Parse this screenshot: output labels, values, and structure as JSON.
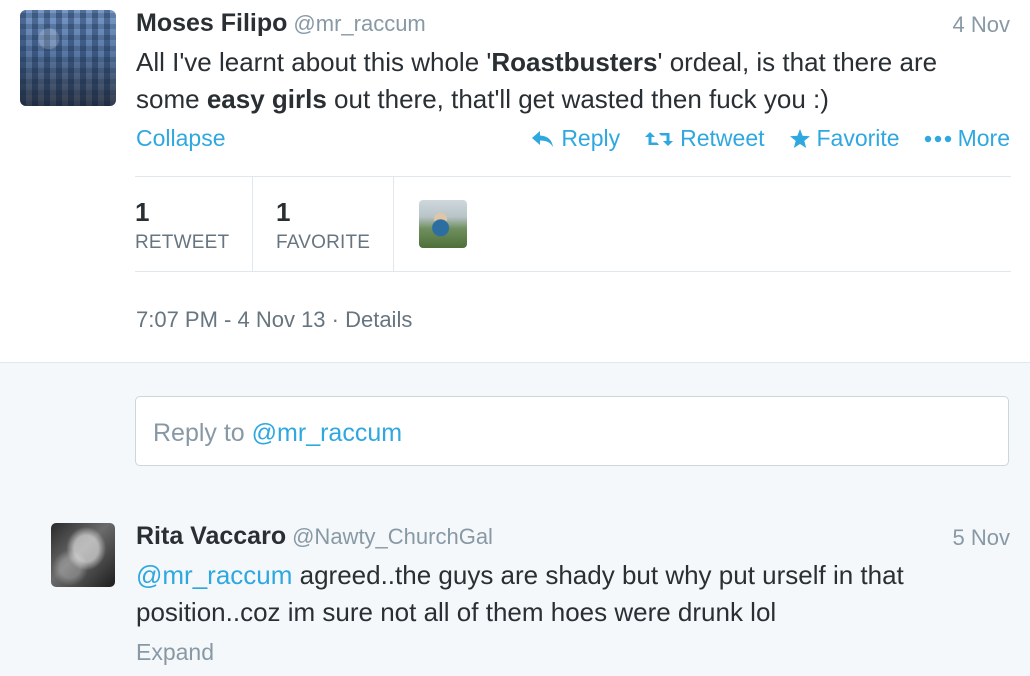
{
  "tweet": {
    "name": "Moses Filipo",
    "handle": "@mr_raccum",
    "time": "4 Nov",
    "text_parts": {
      "p1": "All I've learnt about this whole '",
      "b1": "Roastbusters",
      "p2": "' ordeal, is that there are some ",
      "b2": "easy girls",
      "p3": " out there, that'll get wasted then fuck you :)"
    },
    "collapse_label": "Collapse",
    "actions": {
      "reply": "Reply",
      "retweet": "Retweet",
      "favorite": "Favorite",
      "more": "More"
    },
    "stats": {
      "retweet_count": "1",
      "retweet_label": "RETWEET",
      "favorite_count": "1",
      "favorite_label": "FAVORITE"
    },
    "meta": "7:07 PM - 4 Nov 13 · Details"
  },
  "reply_box": {
    "prefix": "Reply to ",
    "mention": "@mr_raccum"
  },
  "reply_tweet": {
    "name": "Rita Vaccaro",
    "handle": "@Nawty_ChurchGal",
    "time": "5 Nov",
    "mention": "@mr_raccum",
    "text": " agreed..the guys are shady but why put urself in that position..coz im sure not all of them hoes were drunk lol",
    "expand_label": "Expand"
  },
  "colors": {
    "link": "#2fa8e0",
    "muted": "#8899a6",
    "text": "#292f33",
    "background_alt": "#f5f8fa"
  },
  "icons": [
    "reply-icon",
    "retweet-icon",
    "star-icon",
    "more-dots-icon"
  ]
}
